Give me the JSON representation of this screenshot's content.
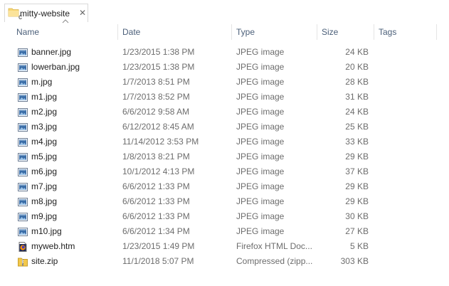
{
  "tab": {
    "title": "mitty-website",
    "close": "✕",
    "cursor_glyph": "c"
  },
  "columns": {
    "name": "Name",
    "date": "Date",
    "type": "Type",
    "size": "Size",
    "tags": "Tags"
  },
  "files": [
    {
      "name": "banner.jpg",
      "date": "1/23/2015 1:38 PM",
      "type": "JPEG image",
      "size": "24 KB",
      "icon": "image-file-icon"
    },
    {
      "name": "lowerban.jpg",
      "date": "1/23/2015 1:38 PM",
      "type": "JPEG image",
      "size": "20 KB",
      "icon": "image-file-icon"
    },
    {
      "name": "m.jpg",
      "date": "1/7/2013 8:51 PM",
      "type": "JPEG image",
      "size": "28 KB",
      "icon": "image-file-icon"
    },
    {
      "name": "m1.jpg",
      "date": "1/7/2013 8:52 PM",
      "type": "JPEG image",
      "size": "31 KB",
      "icon": "image-file-icon"
    },
    {
      "name": "m2.jpg",
      "date": "6/6/2012 9:58 AM",
      "type": "JPEG image",
      "size": "24 KB",
      "icon": "image-file-icon"
    },
    {
      "name": "m3.jpg",
      "date": "6/12/2012 8:45 AM",
      "type": "JPEG image",
      "size": "25 KB",
      "icon": "image-file-icon"
    },
    {
      "name": "m4.jpg",
      "date": "11/14/2012 3:53 PM",
      "type": "JPEG image",
      "size": "33 KB",
      "icon": "image-file-icon"
    },
    {
      "name": "m5.jpg",
      "date": "1/8/2013 8:21 PM",
      "type": "JPEG image",
      "size": "29 KB",
      "icon": "image-file-icon"
    },
    {
      "name": "m6.jpg",
      "date": "10/1/2012 4:13 PM",
      "type": "JPEG image",
      "size": "37 KB",
      "icon": "image-file-icon"
    },
    {
      "name": "m7.jpg",
      "date": "6/6/2012 1:33 PM",
      "type": "JPEG image",
      "size": "29 KB",
      "icon": "image-file-icon"
    },
    {
      "name": "m8.jpg",
      "date": "6/6/2012 1:33 PM",
      "type": "JPEG image",
      "size": "29 KB",
      "icon": "image-file-icon"
    },
    {
      "name": "m9.jpg",
      "date": "6/6/2012 1:33 PM",
      "type": "JPEG image",
      "size": "30 KB",
      "icon": "image-file-icon"
    },
    {
      "name": "m10.jpg",
      "date": "6/6/2012 1:34 PM",
      "type": "JPEG image",
      "size": "27 KB",
      "icon": "image-file-icon"
    },
    {
      "name": "myweb.htm",
      "date": "1/23/2015 1:49 PM",
      "type": "Firefox HTML Doc...",
      "size": "5 KB",
      "icon": "firefox-html-icon"
    },
    {
      "name": "site.zip",
      "date": "11/1/2018 5:07 PM",
      "type": "Compressed (zipp...",
      "size": "303 KB",
      "icon": "zip-folder-icon"
    }
  ],
  "colors": {
    "header_text": "#4c607a",
    "detail_text": "#6d6d6d",
    "name_text": "#1e1e1e",
    "folder_yellow": "#f8d775"
  }
}
